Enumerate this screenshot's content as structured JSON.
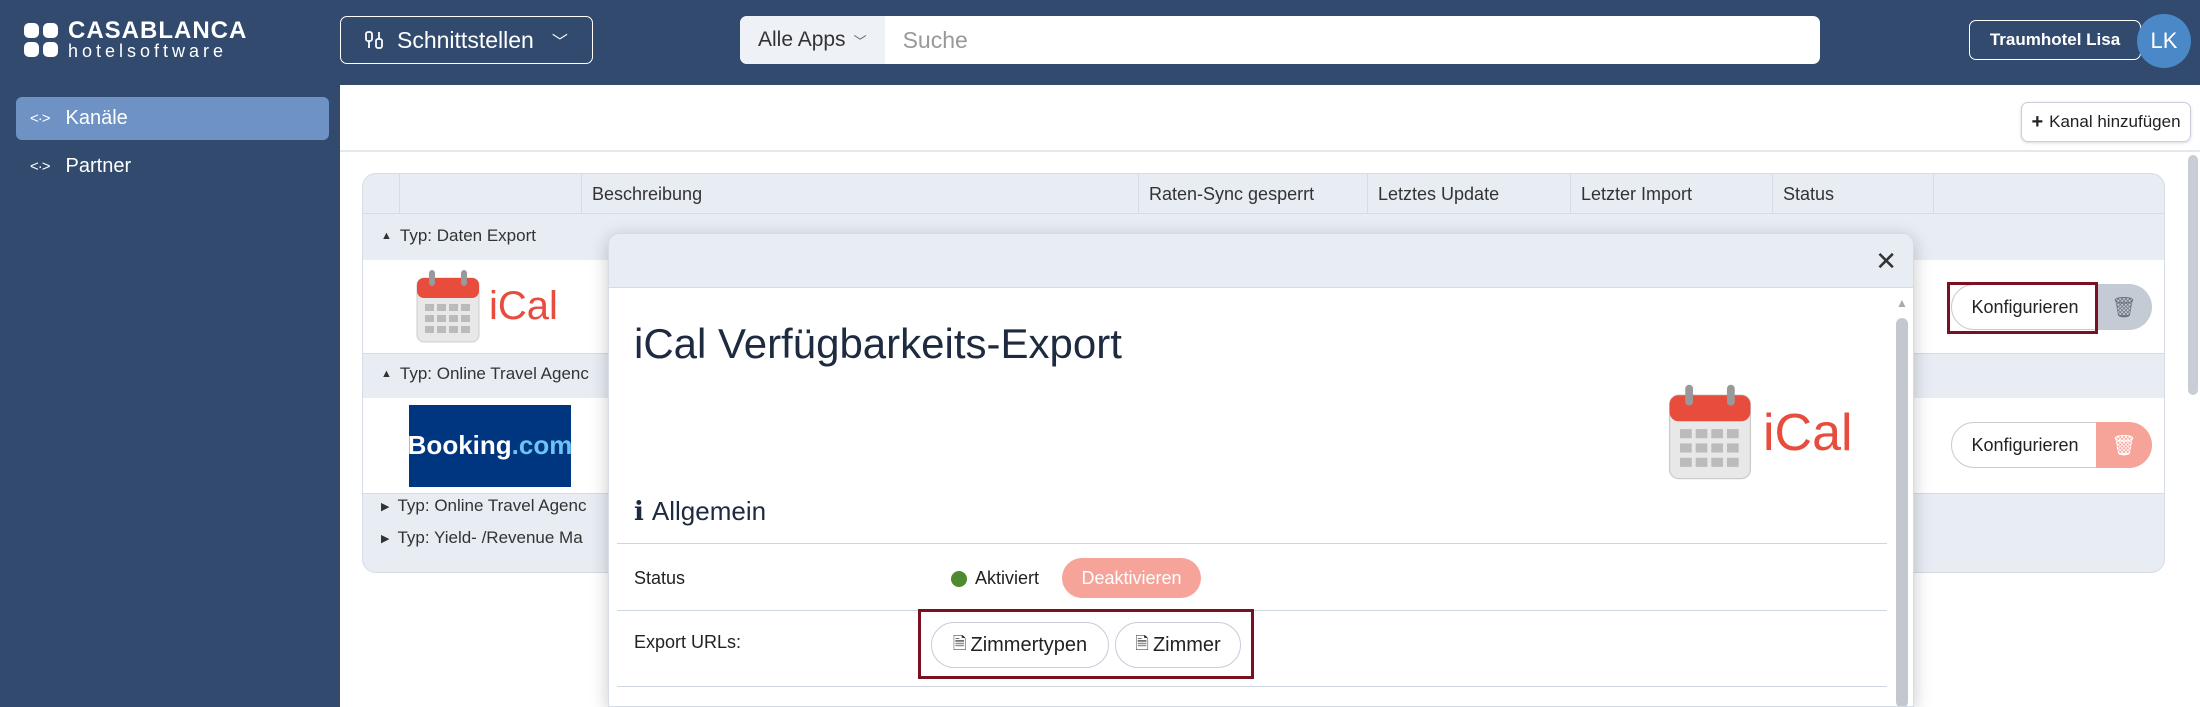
{
  "brand": {
    "line1": "CASABLANCA",
    "line2": "hotelsoftware"
  },
  "header": {
    "module_label": "Schnittstellen",
    "search_scope": "Alle Apps",
    "search_placeholder": "Suche",
    "hotel_label": "Traumhotel Lisa",
    "user_initials": "LK"
  },
  "sidebar": {
    "items": [
      {
        "label": "Kanäle"
      },
      {
        "label": "Partner"
      }
    ]
  },
  "toolbar": {
    "add_label": "Kanal hinzufügen"
  },
  "table": {
    "columns": [
      "Beschreibung",
      "Raten-Sync gesperrt",
      "Letztes Update",
      "Letzter Import",
      "Status"
    ],
    "groups": [
      {
        "label": "Typ: Daten Export"
      },
      {
        "label": "Typ: Online Travel Agenc"
      },
      {
        "label": "Typ: Online Travel Agenc"
      },
      {
        "label": "Typ: Yield- /Revenue Ma"
      }
    ],
    "rows": [
      {
        "logo_text": "iCal",
        "configure_label": "Konfigurieren"
      },
      {
        "logo_text_a": "Booking",
        "logo_text_b": ".com",
        "configure_label": "Konfigurieren"
      }
    ]
  },
  "modal": {
    "title": "iCal Verfügbarkeits-Export",
    "logo_text": "iCal",
    "section_title": "Allgemein",
    "status_label": "Status",
    "status_value": "Aktiviert",
    "deactivate_label": "Deaktivieren",
    "export_label": "Export URLs:",
    "export_buttons": [
      "Zimmertypen",
      "Zimmer"
    ]
  },
  "colors": {
    "topbar": "#314a6e",
    "accent_red": "#e74c3c",
    "highlight": "#7a1020"
  }
}
